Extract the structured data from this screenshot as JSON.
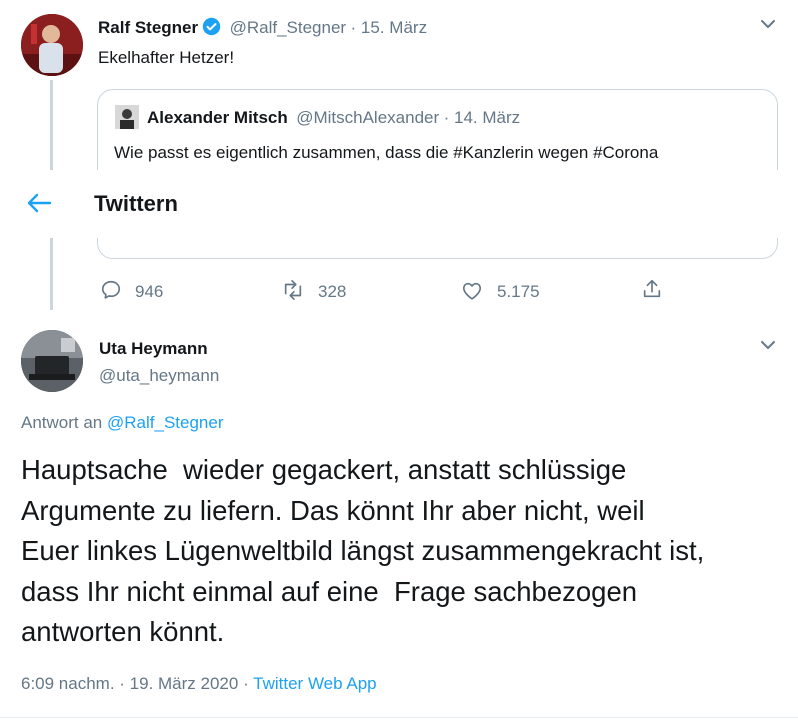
{
  "parent_tweet": {
    "author_name": "Ralf Stegner",
    "handle": "@Ralf_Stegner",
    "date": "· 15. März",
    "text": "Ekelhafter Hetzer!",
    "quoted": {
      "author_name": "Alexander Mitsch",
      "handle": "@MitschAlexander",
      "date": "· 14. März",
      "text": "Wie passt es eigentlich zusammen, dass die #Kanzlerin wegen #Corona"
    },
    "stats": {
      "replies": "946",
      "retweets": "328",
      "likes": "5.175"
    }
  },
  "header": {
    "title": "Twittern"
  },
  "reply_tweet": {
    "author_name": "Uta Heymann",
    "handle": "@uta_heymann",
    "reply_prefix": "Antwort an",
    "reply_target": "@Ralf_Stegner",
    "text_lines": [
      "Hauptsache  wieder gegackert, anstatt schlüssige",
      "Argumente zu liefern. Das könnt Ihr aber nicht, weil",
      "Euer linkes Lügenweltbild längst zusammengekracht ist,",
      "dass Ihr nicht einmal auf eine  Frage sachbezogen",
      "antworten könnt."
    ],
    "timestamp": "6:09 nachm. · 19. März 2020 ·",
    "source": "Twitter Web App"
  },
  "colors": {
    "accent": "#1da1f2",
    "text": "#14171a",
    "secondary": "#657786",
    "border": "#ccd6dd"
  }
}
